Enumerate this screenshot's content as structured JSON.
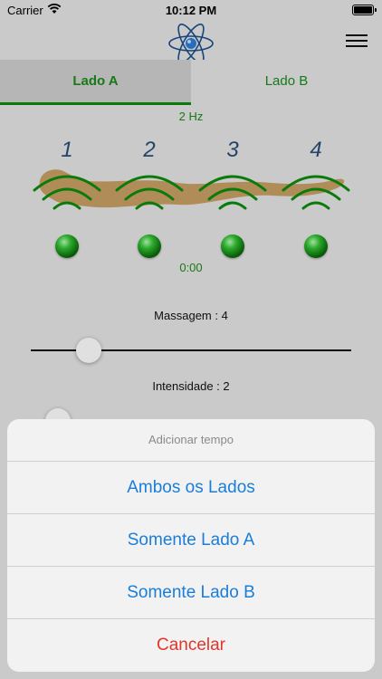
{
  "status": {
    "carrier": "Carrier",
    "time": "10:12 PM"
  },
  "tabs": {
    "a": "Lado A",
    "b": "Lado B"
  },
  "frequency": "2 Hz",
  "zones": [
    "1",
    "2",
    "3",
    "4"
  ],
  "timer": "0:00",
  "massage": {
    "label": "Massagem : 4",
    "level": 0.18
  },
  "intensity": {
    "label": "Intensidade : 2"
  },
  "sheet": {
    "title": "Adicionar tempo",
    "both": "Ambos os Lados",
    "sideA": "Somente Lado  A",
    "sideB": "Somente Lado  B",
    "cancel": "Cancelar"
  },
  "colors": {
    "green": "#1b8a1b",
    "blue": "#1a7ed8",
    "red": "#e0362c"
  }
}
